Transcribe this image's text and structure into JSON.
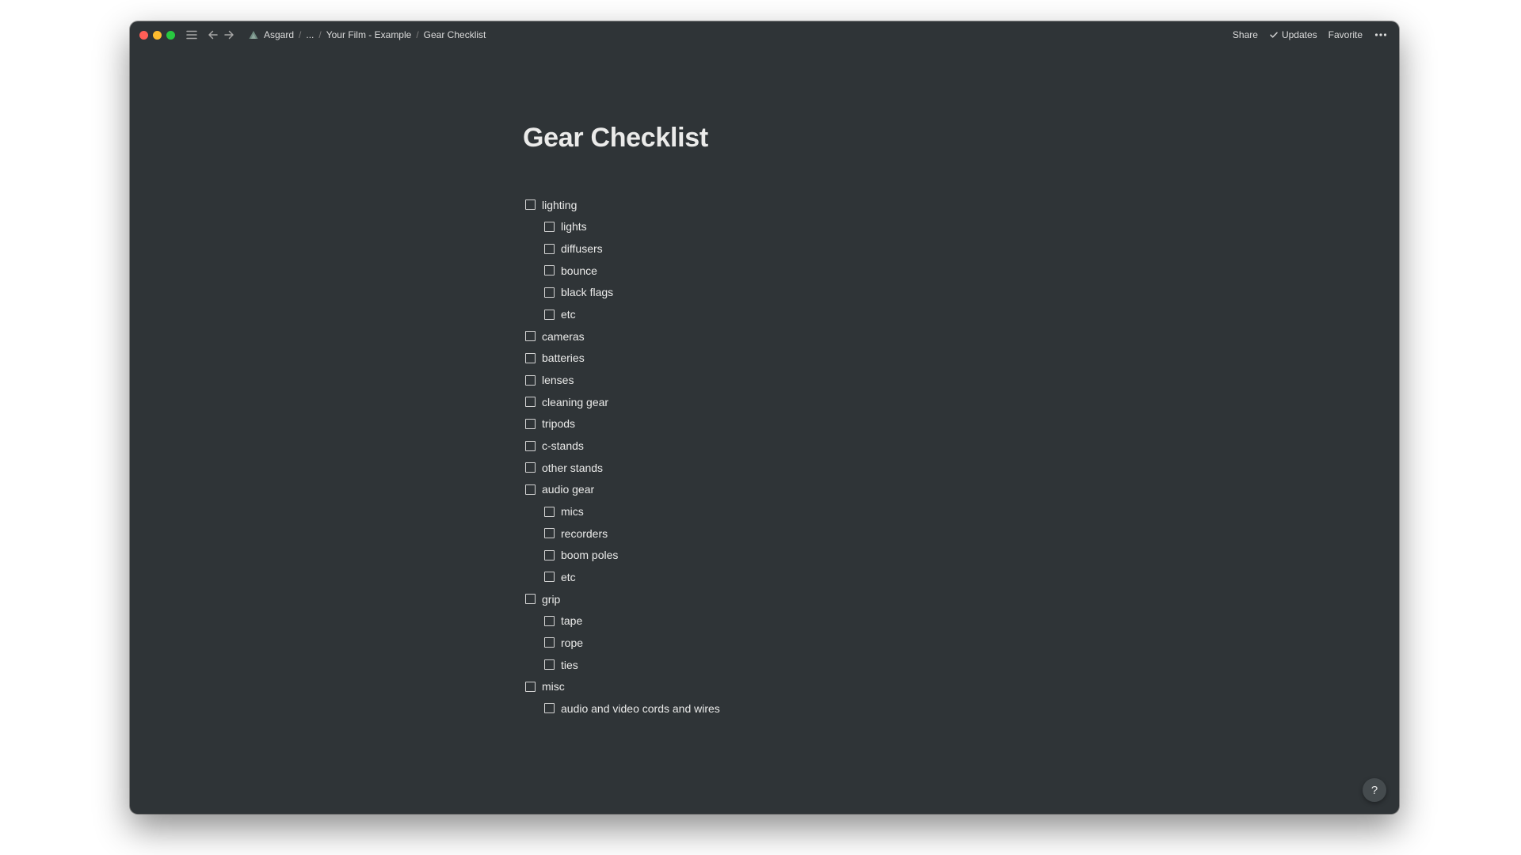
{
  "window": {
    "background": "#2f3437"
  },
  "breadcrumb": {
    "workspace": "Asgard",
    "ellipsis": "...",
    "parent": "Your Film - Example",
    "current": "Gear Checklist"
  },
  "actions": {
    "share": "Share",
    "updates": "Updates",
    "favorite": "Favorite"
  },
  "icons": {
    "menu": "menu-icon",
    "back": "arrow-left-icon",
    "forward": "arrow-right-icon",
    "workspace": "workspace-triangle-icon",
    "updates": "check-icon",
    "more": "more-horizontal-icon",
    "help": "help-icon"
  },
  "page": {
    "title": "Gear Checklist",
    "todos": [
      {
        "label": "lighting",
        "checked": false
      },
      {
        "label": "lights",
        "checked": false
      },
      {
        "label": "diffusers",
        "checked": false
      },
      {
        "label": "bounce",
        "checked": false
      },
      {
        "label": "black flags",
        "checked": false
      },
      {
        "label": "etc",
        "checked": false
      },
      {
        "label": "cameras",
        "checked": false
      },
      {
        "label": "batteries",
        "checked": false
      },
      {
        "label": "lenses",
        "checked": false
      },
      {
        "label": "cleaning gear",
        "checked": false
      },
      {
        "label": "tripods",
        "checked": false
      },
      {
        "label": "c-stands",
        "checked": false
      },
      {
        "label": "other stands",
        "checked": false
      },
      {
        "label": "audio gear",
        "checked": false
      },
      {
        "label": "mics",
        "checked": false
      },
      {
        "label": "recorders",
        "checked": false
      },
      {
        "label": "boom poles",
        "checked": false
      },
      {
        "label": "etc",
        "checked": false
      },
      {
        "label": "grip",
        "checked": false
      },
      {
        "label": "tape",
        "checked": false
      },
      {
        "label": "rope",
        "checked": false
      },
      {
        "label": "ties",
        "checked": false
      },
      {
        "label": "misc",
        "checked": false
      },
      {
        "label": "audio and video cords and wires",
        "checked": false
      }
    ]
  },
  "help": {
    "label": "?"
  }
}
